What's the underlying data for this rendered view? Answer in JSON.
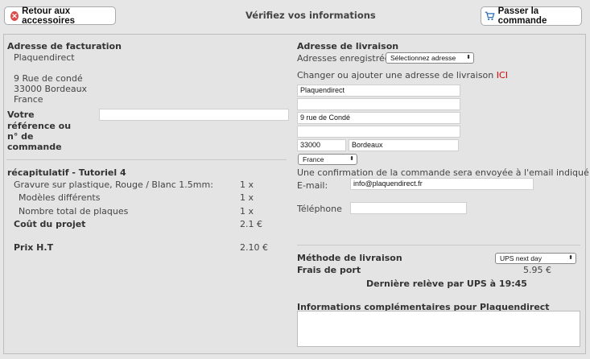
{
  "header": {
    "back_label": "Retour aux accessoires",
    "title": "Vérifiez vos informations",
    "order_label": "Passer la commande"
  },
  "billing": {
    "heading": "Adresse de facturation",
    "company": "Plaquendirect",
    "street": "9 Rue de condé",
    "city": "33000 Bordeaux",
    "country": "France",
    "reference_label_1": "Votre",
    "reference_label_2": "référence ou",
    "reference_label_3": "n° de",
    "reference_label_4": "commande",
    "reference_value": ""
  },
  "summary": {
    "heading": "récapitulatif - Tutoriel 4",
    "rows": [
      {
        "label": "Gravure sur plastique, Rouge / Blanc 1.5mm:",
        "value": "1 x"
      },
      {
        "label": "Modèles différents",
        "value": "1 x"
      },
      {
        "label": "Nombre total de plaques",
        "value": "1 x"
      }
    ],
    "cost_label": "Coût du projet",
    "cost_value": "2.1 €",
    "price_label": "Prix H.T",
    "price_value": "2.10 €"
  },
  "shipping": {
    "heading": "Adresse de livraison",
    "saved_label": "Adresses enregistrées",
    "saved_select": "Sélectionnez adresse",
    "change_text": "Changer ou ajouter une adresse de livraison",
    "change_link": "ICI",
    "fields": {
      "name": "Plaquendirect",
      "line2": "",
      "street": "9 rue de Condé",
      "line4": "",
      "postcode": "33000",
      "city": "Bordeaux"
    },
    "country_select": "France",
    "confirm_text": "Une confirmation de la commande sera envoyée à l'email indiqué",
    "email_label": "E-mail:",
    "email_value": "info@plaquendirect.fr",
    "phone_label": "Téléphone",
    "phone_value": ""
  },
  "delivery": {
    "method_label": "Méthode de livraison",
    "method_select": "UPS next day",
    "fee_label": "Frais de port",
    "fee_value": "5.95 €",
    "pickup_text": "Dernière relève par UPS à 19:45"
  },
  "notes": {
    "heading": "Informations complémentaires pour Plaquendirect",
    "value": ""
  }
}
